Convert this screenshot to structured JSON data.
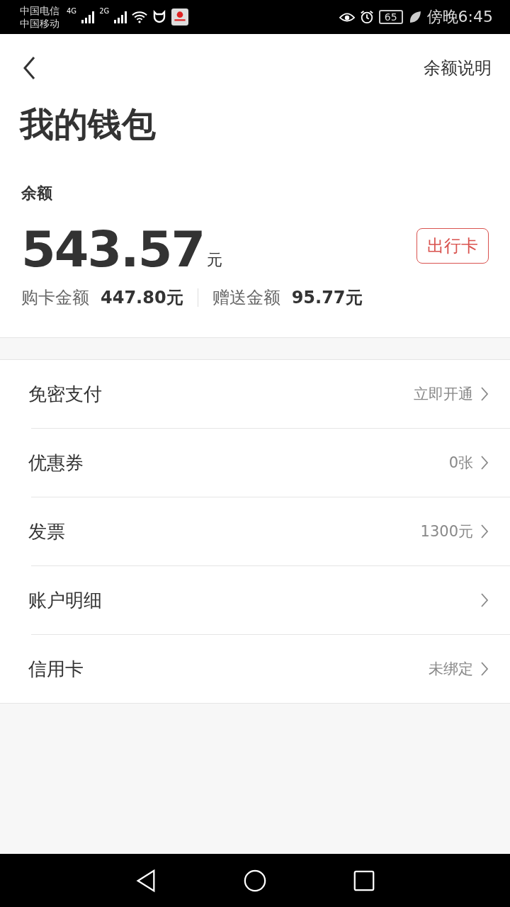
{
  "status_bar": {
    "carriers": [
      "中国电信",
      "中国移动"
    ],
    "network_labels": [
      "4G",
      "2G"
    ],
    "battery": "65",
    "time": "傍晚6:45"
  },
  "header": {
    "action": "余额说明"
  },
  "title": "我的钱包",
  "balance": {
    "label": "余额",
    "amount": "543.57",
    "unit": "元",
    "card_button": "出行卡",
    "details": [
      {
        "label": "购卡金额",
        "value": "447.80元"
      },
      {
        "label": "赠送金额",
        "value": "95.77元"
      }
    ]
  },
  "menu": [
    {
      "label": "免密支付",
      "value": "立即开通"
    },
    {
      "label": "优惠券",
      "value": "0张"
    },
    {
      "label": "发票",
      "value": "1300元"
    },
    {
      "label": "账户明细"
    },
    {
      "label": "信用卡",
      "value": "未绑定"
    }
  ]
}
